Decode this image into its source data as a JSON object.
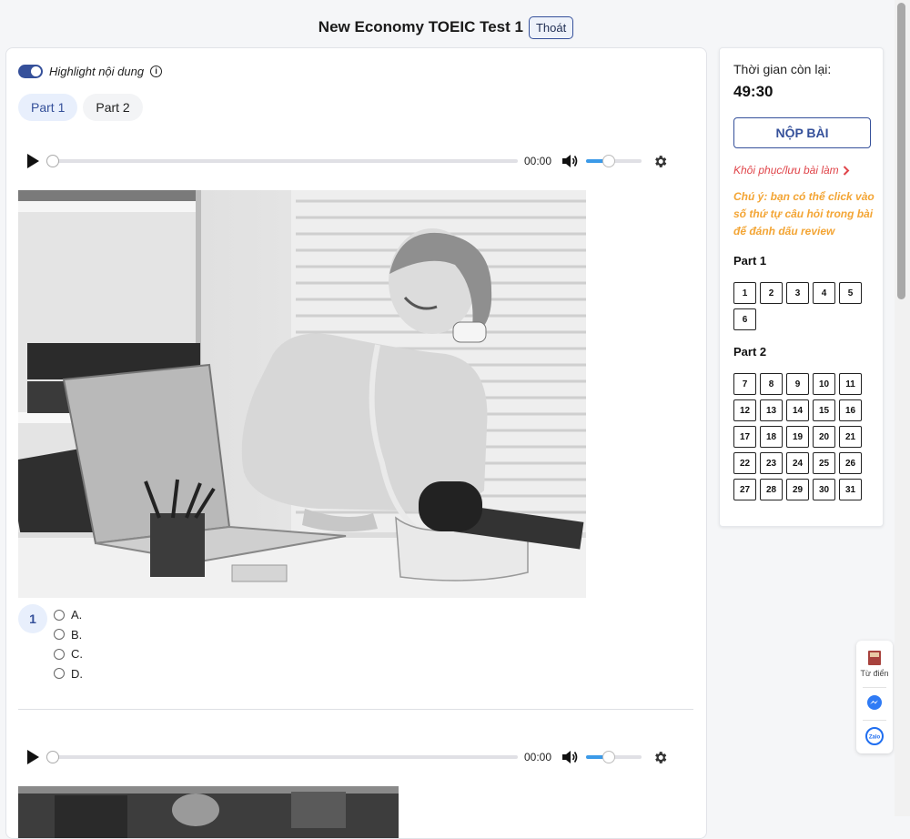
{
  "header": {
    "title": "New Economy TOEIC Test 1",
    "exit_label": "Thoát"
  },
  "highlight": {
    "label": "Highlight nội dung",
    "enabled": true,
    "info_icon": "info-icon"
  },
  "part_tabs": [
    {
      "label": "Part 1",
      "active": true
    },
    {
      "label": "Part 2",
      "active": false
    }
  ],
  "audio_players": [
    {
      "time": "00:00",
      "progress": 0,
      "volume": 0.4
    },
    {
      "time": "00:00",
      "progress": 0,
      "volume": 0.4
    }
  ],
  "questions": [
    {
      "number": "1",
      "options": [
        "A.",
        "B.",
        "C.",
        "D."
      ]
    }
  ],
  "sidebar": {
    "timer_label": "Thời gian còn lại:",
    "timer_value": "49:30",
    "submit_label": "NỘP BÀI",
    "restore_label": "Khôi phục/lưu bài làm",
    "note": "Chú ý: bạn có thể click vào số thứ tự câu hỏi trong bài để đánh dấu review",
    "parts": [
      {
        "label": "Part 1",
        "questions": [
          "1",
          "2",
          "3",
          "4",
          "5",
          "6"
        ]
      },
      {
        "label": "Part 2",
        "questions": [
          "7",
          "8",
          "9",
          "10",
          "11",
          "12",
          "13",
          "14",
          "15",
          "16",
          "17",
          "18",
          "19",
          "20",
          "21",
          "22",
          "23",
          "24",
          "25",
          "26",
          "27",
          "28",
          "29",
          "30",
          "31"
        ]
      }
    ]
  },
  "float_widget": {
    "dictionary_label": "Từ điển",
    "messenger_icon": "messenger-icon",
    "zalo_label": "Zalo"
  },
  "colors": {
    "accent": "#35509a",
    "link_red": "#e0454a",
    "note_orange": "#f3a535",
    "volume_blue": "#3b9ae8"
  }
}
